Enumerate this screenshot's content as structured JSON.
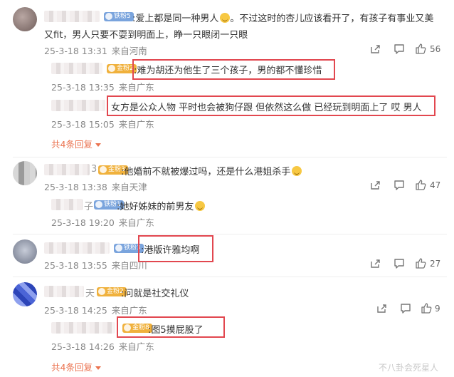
{
  "comments": [
    {
      "text_line1": "爱上都是同一种男人",
      "text_line1_tail": "。不过这时的杏儿应该看开了，有孩子有事业又美",
      "text_line2": "又fit，男人只要不耍到明面上，睁一只眼闭一只眼",
      "badge": "铁粉5",
      "date": "25-3-18 13:31",
      "location": "来自河南",
      "likes": "56",
      "replies": [
        {
          "text": "难为胡还为他生了三个孩子，男的都不懂珍惜",
          "badge": "金粉2",
          "date": "25-3-18 13:35",
          "location": "来自广东"
        },
        {
          "text": "女方是公众人物 平时也会被狗仔跟 但依然这么做 已经玩到明面上了 哎 男人",
          "date": "25-3-18 15:05",
          "location": "来自广东"
        }
      ],
      "more": "共4条回复"
    },
    {
      "text": ":他婚前不就被爆过吗，还是什么港姐杀手",
      "name_tail": "3",
      "badge": "金粉3",
      "date": "25-3-18 13:38",
      "location": "来自天津",
      "likes": "47",
      "replies": [
        {
          "text": ":她好姊妹的前男友",
          "name_tail": "子",
          "badge": "铁粉1",
          "date": "25-3-18 19:20",
          "location": "来自广东"
        }
      ]
    },
    {
      "text": ":港版许雅均啊",
      "badge": "铁粉3",
      "date": "25-3-18 13:55",
      "location": "来自四川",
      "likes": "27"
    },
    {
      "text": ":问就是社交礼仪",
      "name_tail": "天",
      "badge": "金粉2",
      "date": "25-3-18 14:25",
      "location": "来自广东",
      "likes": "9",
      "replies": [
        {
          "text": ":图5摸屁股了",
          "badge": "金粉8",
          "date": "25-3-18 14:26",
          "location": "来自广东"
        }
      ],
      "more": "共4条回复"
    }
  ],
  "watermark": "不八卦会死星人",
  "icons": [
    "share-icon",
    "comment-icon",
    "like-icon"
  ],
  "colors": {
    "highlight_box": "#e2474f",
    "more_link": "#eb7350",
    "badge_blue": "#7aa4dd",
    "badge_gold": "#f0b13c"
  }
}
